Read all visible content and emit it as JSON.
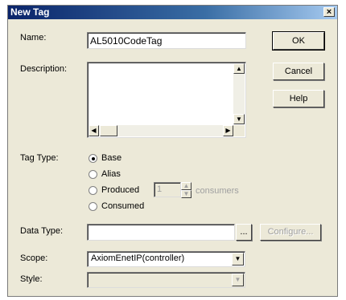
{
  "window": {
    "title": "New Tag",
    "close_glyph": "×"
  },
  "fields": {
    "name_label": "Name:",
    "name_value": "AL5010CodeTag",
    "description_label": "Description:",
    "tag_type_label": "Tag Type:",
    "data_type_label": "Data Type:",
    "scope_label": "Scope:",
    "scope_value": "AxiomEnetIP(controller)",
    "style_label": "Style:"
  },
  "tag_type_options": [
    {
      "label": "Base",
      "selected": true
    },
    {
      "label": "Alias",
      "selected": false
    },
    {
      "label": "Produced",
      "selected": false
    },
    {
      "label": "Consumed",
      "selected": false
    }
  ],
  "produced": {
    "consumers_value": "1",
    "consumers_label": "consumers"
  },
  "buttons": {
    "ok": "OK",
    "cancel": "Cancel",
    "help": "Help",
    "browse": "...",
    "configure": "Configure..."
  },
  "icons": {
    "scroll_up": "▲",
    "scroll_down": "▼",
    "scroll_left": "◀",
    "scroll_right": "▶",
    "dropdown": "▼"
  }
}
